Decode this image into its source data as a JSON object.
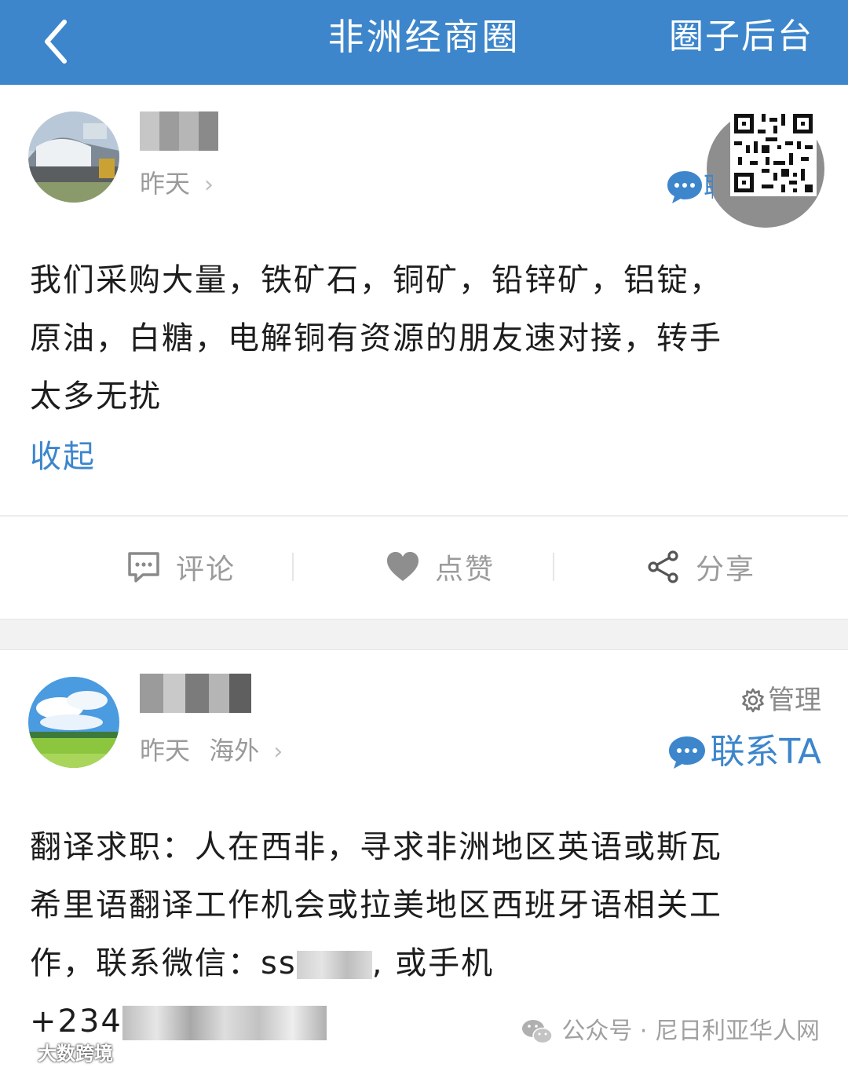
{
  "header": {
    "back_icon": "chevron-left-icon",
    "title": "非洲经商圈",
    "right_action": "圈子后台"
  },
  "posts": [
    {
      "time": "昨天",
      "content_lines": [
        "我们采购大量，铁矿石，铜矿，铅锌矿，铝锭，",
        "原油，白糖，电解铜有资源的朋友速对接，转手",
        "太多无扰"
      ],
      "collapse_label": "收起",
      "contact_partial": "联"
    },
    {
      "time": "昨天",
      "location": "海外",
      "manage_label": "管理",
      "contact_label": "联系TA",
      "content_lines": [
        "翻译求职：人在西非，寻求非洲地区英语或斯瓦",
        "希里语翻译工作机会或拉美地区西班牙语相关工",
        "作，联系微信：ss",
        ", 或手机",
        "+234"
      ]
    }
  ],
  "actions": {
    "comment": "评论",
    "like": "点赞",
    "share": "分享"
  },
  "watermark": {
    "right_text": "公众号 · 尼日利亚华人网",
    "left_text": "大数跨境"
  },
  "colors": {
    "brand_blue": "#3d86cc",
    "muted_gray": "#9b9b9b"
  }
}
